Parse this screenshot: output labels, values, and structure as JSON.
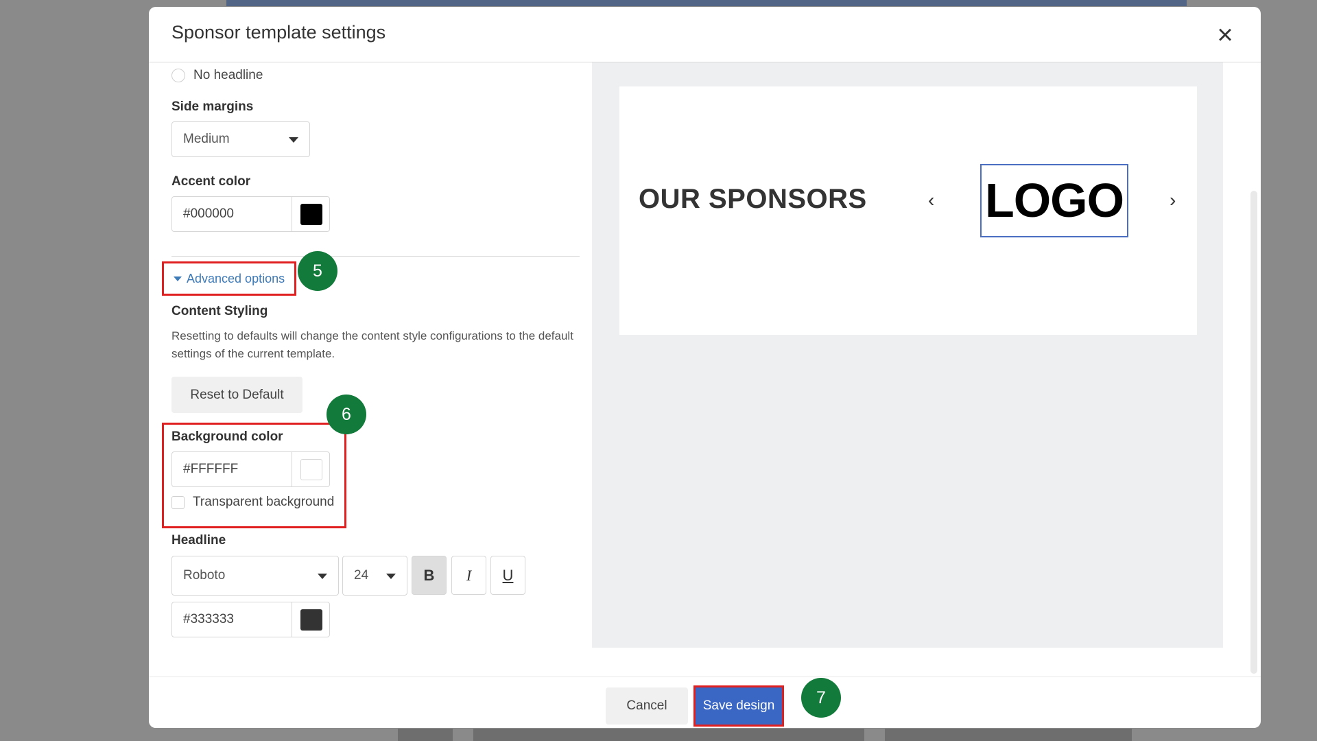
{
  "modal": {
    "title": "Sponsor template settings"
  },
  "form": {
    "no_headline_label": "No headline",
    "side_margins": {
      "label": "Side margins",
      "value": "Medium"
    },
    "accent_color": {
      "label": "Accent color",
      "value": "#000000",
      "swatch": "#000000"
    },
    "advanced_options_label": "Advanced options",
    "content_styling": {
      "heading": "Content Styling",
      "description": "Resetting to defaults will change the content style configurations to the default settings of the current template.",
      "reset_label": "Reset to Default"
    },
    "background_color": {
      "label": "Background color",
      "value": "#FFFFFF",
      "swatch": "#FFFFFF",
      "transparent_label": "Transparent background"
    },
    "headline": {
      "label": "Headline",
      "font": "Roboto",
      "size": "24",
      "bold": "B",
      "italic": "I",
      "underline": "U",
      "color": {
        "value": "#333333",
        "swatch": "#333333"
      }
    }
  },
  "preview": {
    "title": "OUR SPONSORS",
    "logo": "LOGO",
    "prev_arrow": "‹",
    "next_arrow": "›"
  },
  "footer": {
    "cancel_label": "Cancel",
    "save_label": "Save design"
  },
  "annotations": {
    "step5": "5",
    "step6": "6",
    "step7": "7"
  },
  "colors": {
    "accent_blue": "#3a66c4",
    "highlight_red": "#e02020",
    "step_green": "#127a3a",
    "link_blue": "#3d7ab8"
  }
}
